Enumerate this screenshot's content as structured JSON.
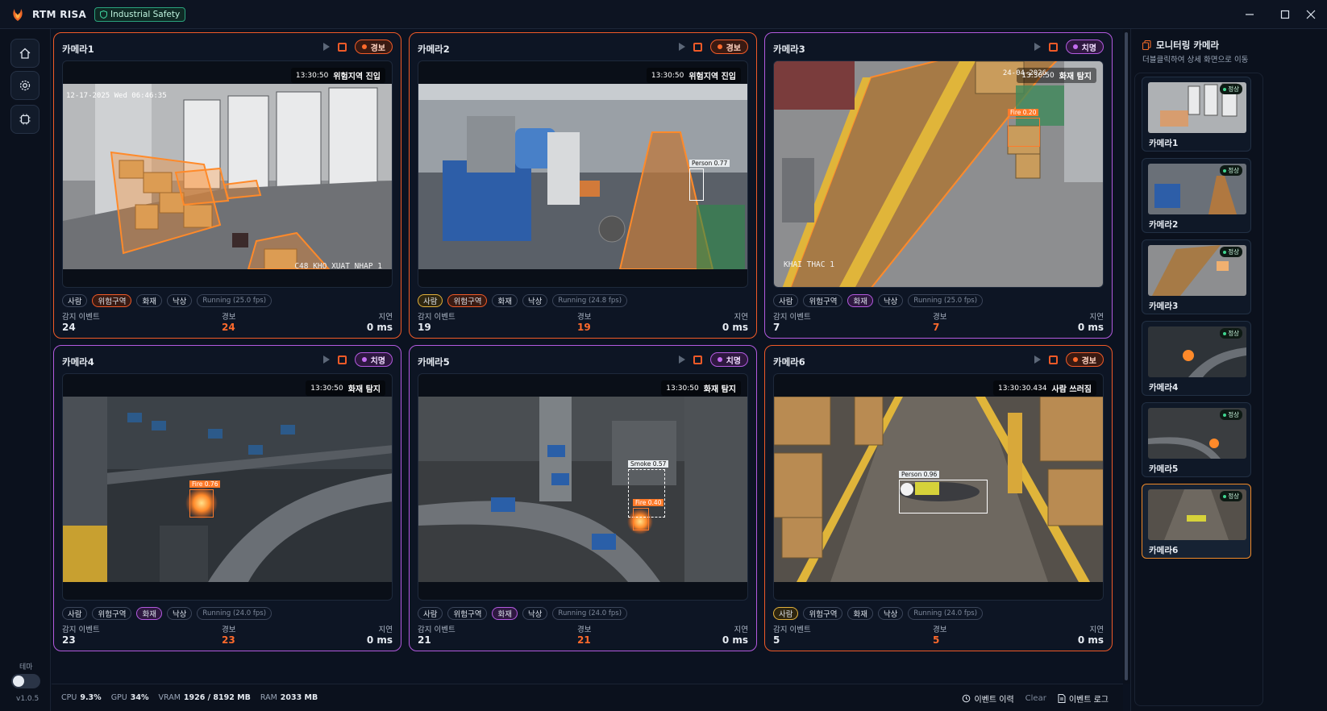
{
  "app": {
    "title": "RTM RISA",
    "badge": "Industrial Safety"
  },
  "window_controls": [
    "minimize",
    "maximize",
    "close"
  ],
  "sidebar": {
    "items": [
      "home-icon",
      "settings-icon",
      "chip-icon"
    ],
    "theme_label": "테마",
    "version": "v1.0.5"
  },
  "cameras": [
    {
      "name": "카메라1",
      "status": "경보",
      "status_type": "alarm",
      "overlay_time": "13:30:50",
      "overlay_event": "위험지역 진입",
      "cam_timestamp": "12-17-2025 Wed 06:46:35",
      "cam_caption": "C48 KHO XUAT NHAP 1",
      "tags": [
        {
          "label": "사람",
          "on": ""
        },
        {
          "label": "위험구역",
          "on": "orange"
        },
        {
          "label": "화재",
          "on": ""
        },
        {
          "label": "낙상",
          "on": ""
        }
      ],
      "fps": "Running (25.0 fps)",
      "stats": {
        "events_label": "감지 이벤트",
        "events": "24",
        "alerts_label": "경보",
        "alerts": "24",
        "latency_label": "지연",
        "latency": "0 ms"
      },
      "detections": []
    },
    {
      "name": "카메라2",
      "status": "경보",
      "status_type": "alarm",
      "overlay_time": "13:30:50",
      "overlay_event": "위험지역 진입",
      "cam_timestamp": "",
      "cam_caption": "",
      "tags": [
        {
          "label": "사람",
          "on": "yellow"
        },
        {
          "label": "위험구역",
          "on": "orange"
        },
        {
          "label": "화재",
          "on": ""
        },
        {
          "label": "낙상",
          "on": ""
        }
      ],
      "fps": "Running (24.8 fps)",
      "stats": {
        "events_label": "감지 이벤트",
        "events": "19",
        "alerts_label": "경보",
        "alerts": "19",
        "latency_label": "지연",
        "latency": "0 ms"
      },
      "detections": [
        {
          "label": "Person",
          "score": "0.77"
        }
      ]
    },
    {
      "name": "카메라3",
      "status": "치명",
      "status_type": "fatal",
      "overlay_time": "13:30:50",
      "overlay_event": "화재 탐지",
      "cam_timestamp": "24-04-2026",
      "cam_caption": "KHAI THAC 1",
      "tags": [
        {
          "label": "사람",
          "on": ""
        },
        {
          "label": "위험구역",
          "on": ""
        },
        {
          "label": "화재",
          "on": "purple"
        },
        {
          "label": "낙상",
          "on": ""
        }
      ],
      "fps": "Running (25.0 fps)",
      "stats": {
        "events_label": "감지 이벤트",
        "events": "7",
        "alerts_label": "경보",
        "alerts": "7",
        "latency_label": "지연",
        "latency": "0 ms"
      },
      "detections": [
        {
          "label": "Fire",
          "score": "0.20"
        }
      ]
    },
    {
      "name": "카메라4",
      "status": "치명",
      "status_type": "fatal",
      "overlay_time": "13:30:50",
      "overlay_event": "화재 탐지",
      "cam_timestamp": "",
      "cam_caption": "",
      "tags": [
        {
          "label": "사람",
          "on": ""
        },
        {
          "label": "위험구역",
          "on": ""
        },
        {
          "label": "화재",
          "on": "purple"
        },
        {
          "label": "낙상",
          "on": ""
        }
      ],
      "fps": "Running (24.0 fps)",
      "stats": {
        "events_label": "감지 이벤트",
        "events": "23",
        "alerts_label": "경보",
        "alerts": "23",
        "latency_label": "지연",
        "latency": "0 ms"
      },
      "detections": [
        {
          "label": "Fire",
          "score": "0.76"
        }
      ]
    },
    {
      "name": "카메라5",
      "status": "치명",
      "status_type": "fatal",
      "overlay_time": "13:30:50",
      "overlay_event": "화재 탐지",
      "cam_timestamp": "",
      "cam_caption": "",
      "tags": [
        {
          "label": "사람",
          "on": ""
        },
        {
          "label": "위험구역",
          "on": ""
        },
        {
          "label": "화재",
          "on": "purple"
        },
        {
          "label": "낙상",
          "on": ""
        }
      ],
      "fps": "Running (24.0 fps)",
      "stats": {
        "events_label": "감지 이벤트",
        "events": "21",
        "alerts_label": "경보",
        "alerts": "21",
        "latency_label": "지연",
        "latency": "0 ms"
      },
      "detections": [
        {
          "label": "Smoke",
          "score": "0.57"
        },
        {
          "label": "Fire",
          "score": "0.40"
        }
      ]
    },
    {
      "name": "카메라6",
      "status": "경보",
      "status_type": "alarm",
      "overlay_time": "13:30:30.434",
      "overlay_event": "사람 쓰러짐",
      "cam_timestamp": "",
      "cam_caption": "",
      "tags": [
        {
          "label": "사람",
          "on": "yellow"
        },
        {
          "label": "위험구역",
          "on": ""
        },
        {
          "label": "화재",
          "on": ""
        },
        {
          "label": "낙상",
          "on": ""
        }
      ],
      "fps": "Running (24.0 fps)",
      "stats": {
        "events_label": "감지 이벤트",
        "events": "5",
        "alerts_label": "경보",
        "alerts": "5",
        "latency_label": "지연",
        "latency": "0 ms"
      },
      "detections": [
        {
          "label": "Person",
          "score": "0.96"
        }
      ]
    }
  ],
  "monitor_panel": {
    "title": "모니터링 카메라",
    "subtitle": "더블클릭하여 상세 화면으로 이동",
    "thumbs": [
      {
        "name": "카메라1",
        "badge": "정상"
      },
      {
        "name": "카메라2",
        "badge": "정상"
      },
      {
        "name": "카메라3",
        "badge": "정상"
      },
      {
        "name": "카메라4",
        "badge": "정상"
      },
      {
        "name": "카메라5",
        "badge": "정상"
      },
      {
        "name": "카메라6",
        "badge": "정상"
      }
    ]
  },
  "footer": {
    "cpu_label": "CPU",
    "cpu": "9.3%",
    "gpu_label": "GPU",
    "gpu": "34%",
    "vram_label": "VRAM",
    "vram": "1926 / 8192 MB",
    "ram_label": "RAM",
    "ram": "2033 MB",
    "history_label": "이벤트 이력",
    "clear_label": "Clear",
    "log_label": "이벤트 로그"
  },
  "colors": {
    "alarm": "#f05a28",
    "fatal": "#b35adf",
    "accent": "#2aa37d",
    "selected": "#f08a28"
  }
}
